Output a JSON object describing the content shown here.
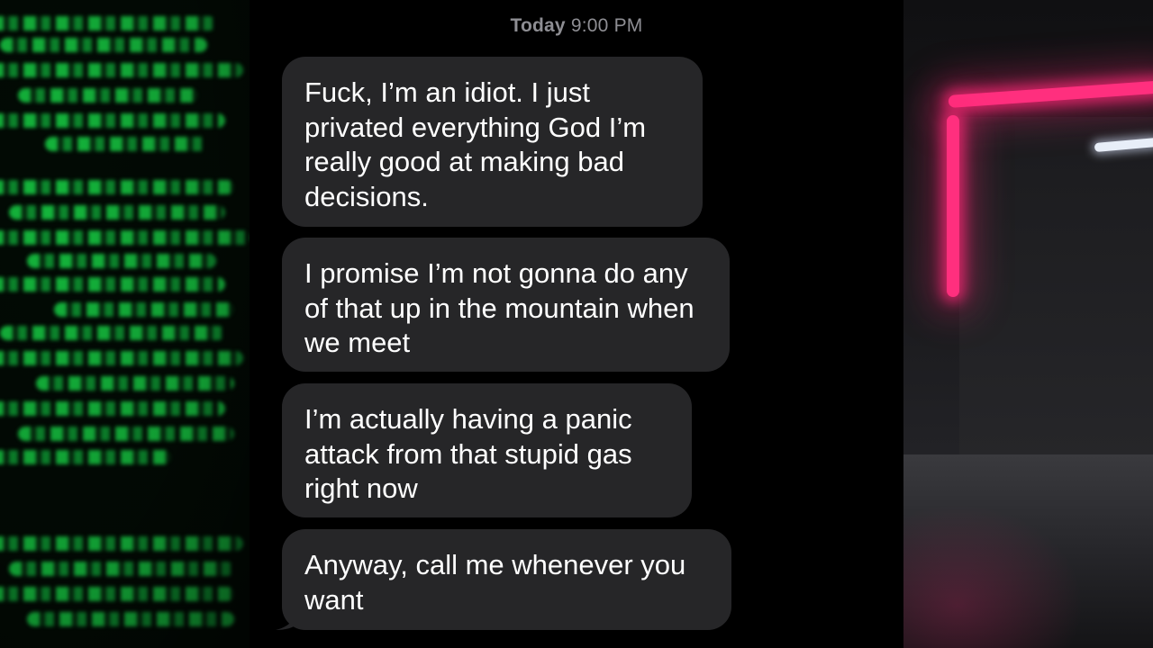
{
  "conversation": {
    "timestamp_day": "Today",
    "timestamp_time": "9:00 PM",
    "messages": [
      {
        "text": "Fuck, I’m an idiot. I just privated everything God I’m really good at making bad decisions."
      },
      {
        "text": "I promise I’m not gonna do any of that up in the mountain when we meet"
      },
      {
        "text": "I’m actually having a panic attack from that stupid gas right now"
      },
      {
        "text": "Anyway, call me whenever you want"
      }
    ]
  },
  "colors": {
    "bubble_incoming": "#262628",
    "timestamp_text": "#8e8e93",
    "background": "#000000",
    "code_green": "#19e04a",
    "neon_pink": "#ff2f7e"
  }
}
